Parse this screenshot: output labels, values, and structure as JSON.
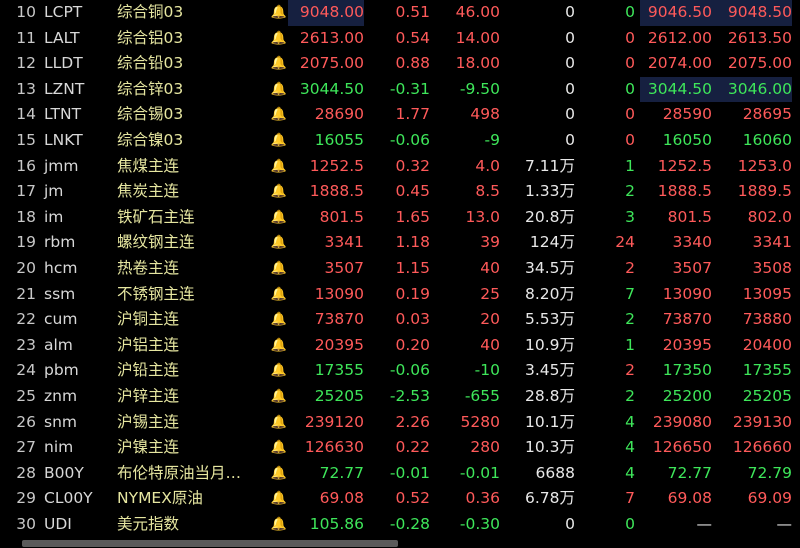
{
  "rows": [
    {
      "idx": "10",
      "code": "LCPT",
      "name": "综合铜03",
      "last": "9048.00",
      "chg": "0.51",
      "chgv": "46.00",
      "vol": "0",
      "cur": "0",
      "bid": "9046.50",
      "ask": "9048.50",
      "dir": "red",
      "curc": "green",
      "hl_last": true,
      "hl_bid": true
    },
    {
      "idx": "11",
      "code": "LALT",
      "name": "综合铝03",
      "last": "2613.00",
      "chg": "0.54",
      "chgv": "14.00",
      "vol": "0",
      "cur": "0",
      "bid": "2612.00",
      "ask": "2613.50",
      "dir": "red",
      "curc": "red"
    },
    {
      "idx": "12",
      "code": "LLDT",
      "name": "综合铅03",
      "last": "2075.00",
      "chg": "0.88",
      "chgv": "18.00",
      "vol": "0",
      "cur": "0",
      "bid": "2074.00",
      "ask": "2075.00",
      "dir": "red",
      "curc": "red"
    },
    {
      "idx": "13",
      "code": "LZNT",
      "name": "综合锌03",
      "last": "3044.50",
      "chg": "-0.31",
      "chgv": "-9.50",
      "vol": "0",
      "cur": "0",
      "bid": "3044.50",
      "ask": "3046.00",
      "dir": "green",
      "curc": "green",
      "hl_bid": true
    },
    {
      "idx": "14",
      "code": "LTNT",
      "name": "综合锡03",
      "last": "28690",
      "chg": "1.77",
      "chgv": "498",
      "vol": "0",
      "cur": "0",
      "bid": "28590",
      "ask": "28695",
      "dir": "red",
      "curc": "red"
    },
    {
      "idx": "15",
      "code": "LNKT",
      "name": "综合镍03",
      "last": "16055",
      "chg": "-0.06",
      "chgv": "-9",
      "vol": "0",
      "cur": "0",
      "bid": "16050",
      "ask": "16060",
      "dir": "green",
      "curc": "red"
    },
    {
      "idx": "16",
      "code": "jmm",
      "name": "焦煤主连",
      "last": "1252.5",
      "chg": "0.32",
      "chgv": "4.0",
      "vol": "7.11万",
      "cur": "1",
      "bid": "1252.5",
      "ask": "1253.0",
      "dir": "red",
      "curc": "green"
    },
    {
      "idx": "17",
      "code": "jm",
      "name": "焦炭主连",
      "last": "1888.5",
      "chg": "0.45",
      "chgv": "8.5",
      "vol": "1.33万",
      "cur": "2",
      "bid": "1888.5",
      "ask": "1889.5",
      "dir": "red",
      "curc": "green"
    },
    {
      "idx": "18",
      "code": "im",
      "name": "铁矿石主连",
      "last": "801.5",
      "chg": "1.65",
      "chgv": "13.0",
      "vol": "20.8万",
      "cur": "3",
      "bid": "801.5",
      "ask": "802.0",
      "dir": "red",
      "curc": "green"
    },
    {
      "idx": "19",
      "code": "rbm",
      "name": "螺纹钢主连",
      "last": "3341",
      "chg": "1.18",
      "chgv": "39",
      "vol": "124万",
      "cur": "24",
      "bid": "3340",
      "ask": "3341",
      "dir": "red",
      "curc": "red"
    },
    {
      "idx": "20",
      "code": "hcm",
      "name": "热卷主连",
      "last": "3507",
      "chg": "1.15",
      "chgv": "40",
      "vol": "34.5万",
      "cur": "2",
      "bid": "3507",
      "ask": "3508",
      "dir": "red",
      "curc": "red"
    },
    {
      "idx": "21",
      "code": "ssm",
      "name": "不锈钢主连",
      "last": "13090",
      "chg": "0.19",
      "chgv": "25",
      "vol": "8.20万",
      "cur": "7",
      "bid": "13090",
      "ask": "13095",
      "dir": "red",
      "curc": "green"
    },
    {
      "idx": "22",
      "code": "cum",
      "name": "沪铜主连",
      "last": "73870",
      "chg": "0.03",
      "chgv": "20",
      "vol": "5.53万",
      "cur": "2",
      "bid": "73870",
      "ask": "73880",
      "dir": "red",
      "curc": "green"
    },
    {
      "idx": "23",
      "code": "alm",
      "name": "沪铝主连",
      "last": "20395",
      "chg": "0.20",
      "chgv": "40",
      "vol": "10.9万",
      "cur": "1",
      "bid": "20395",
      "ask": "20400",
      "dir": "red",
      "curc": "green"
    },
    {
      "idx": "24",
      "code": "pbm",
      "name": "沪铅主连",
      "last": "17355",
      "chg": "-0.06",
      "chgv": "-10",
      "vol": "3.45万",
      "cur": "2",
      "bid": "17350",
      "ask": "17355",
      "dir": "green",
      "curc": "red"
    },
    {
      "idx": "25",
      "code": "znm",
      "name": "沪锌主连",
      "last": "25205",
      "chg": "-2.53",
      "chgv": "-655",
      "vol": "28.8万",
      "cur": "2",
      "bid": "25200",
      "ask": "25205",
      "dir": "green",
      "curc": "green"
    },
    {
      "idx": "26",
      "code": "snm",
      "name": "沪锡主连",
      "last": "239120",
      "chg": "2.26",
      "chgv": "5280",
      "vol": "10.1万",
      "cur": "4",
      "bid": "239080",
      "ask": "239130",
      "dir": "red",
      "curc": "green"
    },
    {
      "idx": "27",
      "code": "nim",
      "name": "沪镍主连",
      "last": "126630",
      "chg": "0.22",
      "chgv": "280",
      "vol": "10.3万",
      "cur": "4",
      "bid": "126650",
      "ask": "126660",
      "dir": "red",
      "curc": "green"
    },
    {
      "idx": "28",
      "code": "B00Y",
      "name": "布伦特原油当月…",
      "last": "72.77",
      "chg": "-0.01",
      "chgv": "-0.01",
      "vol": "6688",
      "cur": "4",
      "bid": "72.77",
      "ask": "72.79",
      "dir": "green",
      "curc": "green"
    },
    {
      "idx": "29",
      "code": "CL00Y",
      "name": "NYMEX原油",
      "last": "69.08",
      "chg": "0.52",
      "chgv": "0.36",
      "vol": "6.78万",
      "cur": "7",
      "bid": "69.08",
      "ask": "69.09",
      "dir": "red",
      "curc": "red"
    },
    {
      "idx": "30",
      "code": "UDI",
      "name": "美元指数",
      "last": "105.86",
      "chg": "-0.28",
      "chgv": "-0.30",
      "vol": "0",
      "cur": "0",
      "bid": "—",
      "ask": "—",
      "dir": "green",
      "curc": "green"
    }
  ],
  "colors": {
    "up": "#ff5a5a",
    "down": "#3ee65a",
    "name": "#e6e6a0",
    "highlight": "#162040"
  },
  "icons": {
    "alert": "bell-icon"
  }
}
